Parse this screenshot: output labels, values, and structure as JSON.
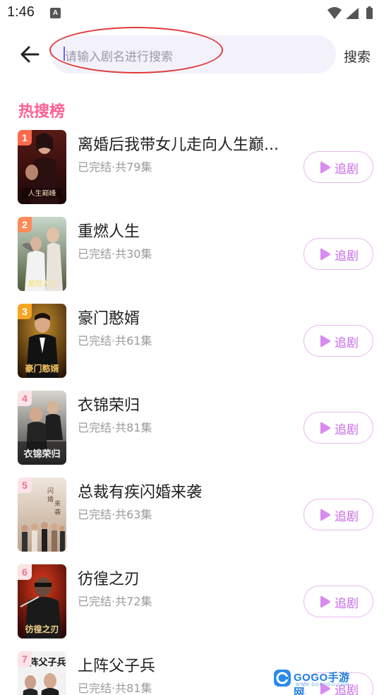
{
  "status_bar": {
    "time": "1:46",
    "notification_icon": "a-icon",
    "icons": [
      "wifi-icon",
      "signal-icon",
      "battery-icon"
    ]
  },
  "search": {
    "placeholder": "请输入剧名进行搜索",
    "button_label": "搜索",
    "back_icon": "arrow-left-icon"
  },
  "hot_list": {
    "title": "热搜榜",
    "follow_label": "追剧",
    "items": [
      {
        "rank": "1",
        "title": "离婚后我带女儿走向人生巅...",
        "meta": "已完结·共79集"
      },
      {
        "rank": "2",
        "title": "重燃人生",
        "meta": "已完结·共30集"
      },
      {
        "rank": "3",
        "title": "豪门憨婿",
        "meta": "已完结·共61集"
      },
      {
        "rank": "4",
        "title": "衣锦荣归",
        "meta": "已完结·共81集"
      },
      {
        "rank": "5",
        "title": "总裁有疾闪婚来袭",
        "meta": "已完结·共63集"
      },
      {
        "rank": "6",
        "title": "彷徨之刃",
        "meta": "已完结·共72集"
      },
      {
        "rank": "7",
        "title": "上阵父子兵",
        "meta": "已完结·共81集"
      }
    ]
  },
  "watermark": {
    "text": "GOGO手游网",
    "subtext": "WWW.GOGOGO.COM"
  },
  "colors": {
    "accent": "#ff5f8f",
    "follow": "#c86be8",
    "annotation": "#e23a3a"
  }
}
